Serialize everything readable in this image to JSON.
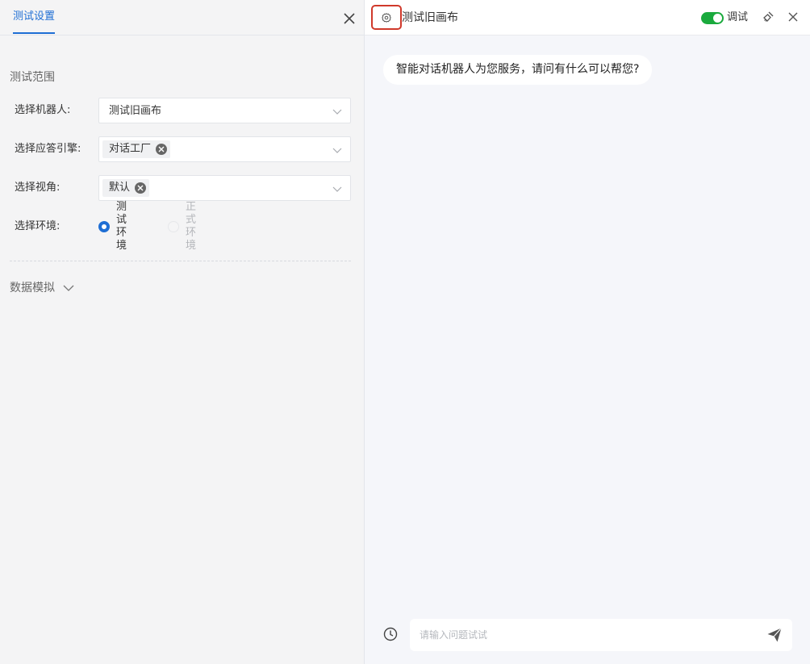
{
  "left_panel": {
    "tab_label": "测试设置",
    "section_title": "测试范围",
    "robot": {
      "label": "选择机器人:",
      "value": "测试旧画布"
    },
    "engine": {
      "label": "选择应答引擎:",
      "tag": "对话工厂"
    },
    "view": {
      "label": "选择视角:",
      "tag": "默认"
    },
    "env": {
      "label": "选择环境:",
      "options": [
        "测试环境",
        "正式环境"
      ],
      "selected": "测试环境"
    },
    "data_mock_label": "数据模拟"
  },
  "right_panel": {
    "title": "测试旧画布",
    "debug_label": "调试",
    "debug_on": true,
    "accent_color": "#1aaa3d",
    "messages": [
      {
        "from": "bot",
        "text": "智能对话机器人为您服务，请问有什么可以帮您?"
      }
    ],
    "input_placeholder": "请输入问题试试"
  },
  "theme": {
    "primary": "#1e6ed4",
    "highlight_border": "#d0392b"
  }
}
